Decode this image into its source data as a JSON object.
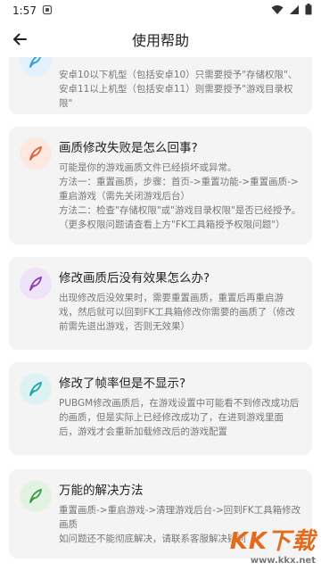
{
  "status_bar": {
    "time": "1:57"
  },
  "header": {
    "title": "使用帮助"
  },
  "cards": [
    {
      "title": "",
      "body": [
        "安卓10以下机型（包括安卓10）只需要授予\"存储权限\"、安卓11以上机型（包括安卓11）则需要授予\"游戏目录权限\""
      ],
      "icon_color": "#2f9fd9",
      "icon_bg": "#e2f1fb"
    },
    {
      "title": "画质修改失败是怎么回事?",
      "body": [
        "可能是你的游戏画质文件已经损坏或异常。",
        "方法一：重置画质，步骤：首页->重置功能->重置画质->重启游戏（需先关闭游戏后台）",
        "方法二：检查\"存储权限\"或\"游戏目录权限\"是否已经授予。（更多权限问题请查看上方\"FK工具箱授予权限问题\"）"
      ],
      "icon_color": "#e0603a",
      "icon_bg": "#fde8e0"
    },
    {
      "title": "修改画质后没有效果怎么办?",
      "body": [
        "出现修改后没效果时，需要重置画质，重置后再重启游戏，然后就可以回到FK工具箱修改你需要的画质了（修改前需先退出游戏，否则无效果）"
      ],
      "icon_color": "#8a3fb8",
      "icon_bg": "#efe3f7"
    },
    {
      "title": "修改了帧率但是不显示?",
      "body": [
        "PUBGM修改画质后，在游戏设置中可能看不到修改成功后的画质，但是实际上已经修改成功了，在进到游戏里面后，游戏才会重新加载修改后的游戏配置"
      ],
      "icon_color": "#1aa6a6",
      "icon_bg": "#ddf3f3"
    },
    {
      "title": "万能的解决方法",
      "body": [
        "重置画质->重启游戏->清理游戏后台->回到FK工具箱修改画质",
        "如问题还不能彻底解决，请联系客服解决疑问"
      ],
      "icon_color": "#3a9a4a",
      "icon_bg": "#e2f3e4"
    }
  ],
  "watermark": {
    "logo": "KK下载",
    "url": "www.kkx.net"
  }
}
